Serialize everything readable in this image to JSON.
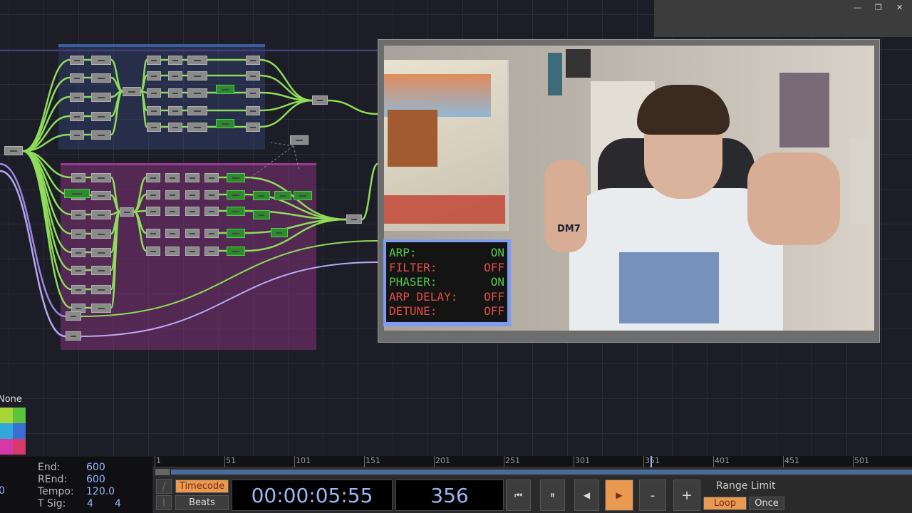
{
  "window_controls": {
    "minimize": "—",
    "restore": "❐",
    "close": "✕"
  },
  "overlay": {
    "rows": [
      {
        "label": "ARP:",
        "value": "ON",
        "state": "on"
      },
      {
        "label": "FILTER:",
        "value": "OFF",
        "state": "off"
      },
      {
        "label": "PHASER:",
        "value": "ON",
        "state": "on"
      },
      {
        "label": "ARP DELAY:",
        "value": "OFF",
        "state": "off"
      },
      {
        "label": "DETUNE:",
        "value": "OFF",
        "state": "off"
      }
    ]
  },
  "video": {
    "hand_text": "DM7"
  },
  "palette": {
    "label": "None",
    "colors": [
      "#a6d63a",
      "#5cc33a",
      "#33a7d9",
      "#3a6fd6",
      "#d639a6",
      "#d63a6a"
    ]
  },
  "timeline": {
    "left_partial": "0",
    "end_label": "End:",
    "end": "600",
    "rend_label": "REnd:",
    "rend": "600",
    "tempo_label": "Tempo:",
    "tempo": "120.0",
    "tsig_label": "T Sig:",
    "tsig_num": "4",
    "tsig_den": "4",
    "ruler_ticks": [
      "1",
      "51",
      "101",
      "151",
      "201",
      "251",
      "301",
      "351",
      "401",
      "451",
      "501"
    ],
    "current_frame_marker": 356,
    "timecode_label": "Timecode",
    "beats_label": "Beats",
    "timecode": "00:00:05:55",
    "frame": "356",
    "range_limit_label": "Range Limit",
    "loop_label": "Loop",
    "once_label": "Once",
    "minus": "-",
    "plus": "+"
  }
}
